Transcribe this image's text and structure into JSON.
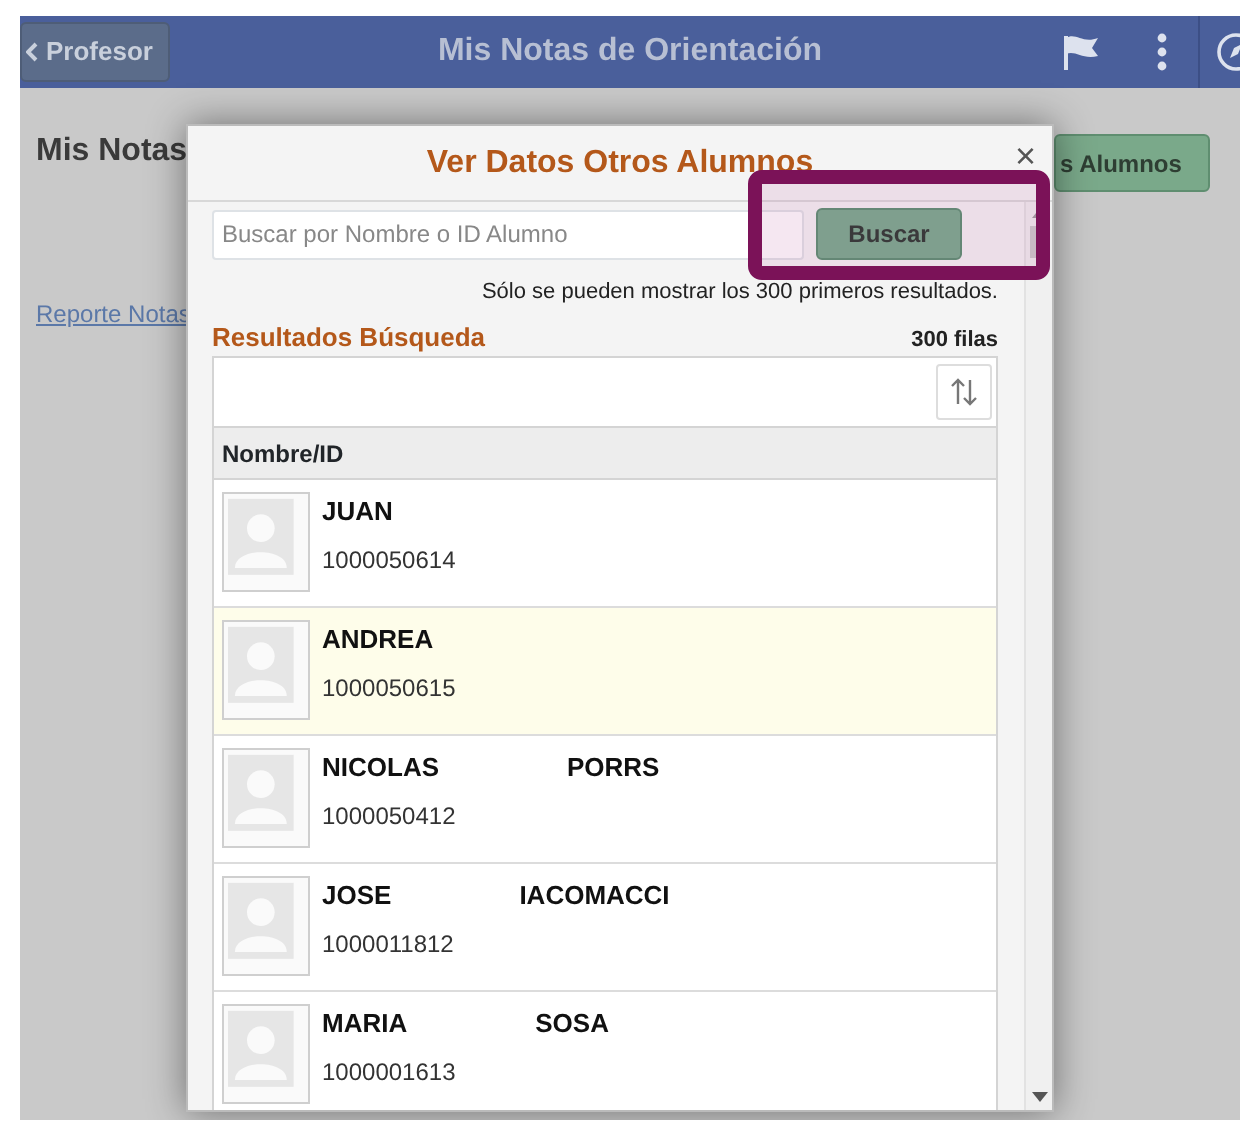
{
  "header": {
    "back_button": "Profesor",
    "title": "Mis Notas de Orientación"
  },
  "background": {
    "page_title": "Mis Notas",
    "link": "Reporte Notas",
    "button": "s Alumnos"
  },
  "modal": {
    "title": "Ver Datos Otros Alumnos",
    "close": "×",
    "search": {
      "placeholder": "Buscar por Nombre o ID Alumno",
      "button": "Buscar"
    },
    "note": "Sólo se pueden mostrar los 300 primeros resultados.",
    "results_title": "Resultados Búsqueda",
    "row_count": "300 filas",
    "column": "Nombre/ID",
    "rows": [
      {
        "first_name": "JUAN",
        "id": "1000050614",
        "selected": false
      },
      {
        "first_name": "ANDREA",
        "id": "1000050615",
        "selected": true
      },
      {
        "first_name": "NICOLAS",
        "last_name": "PORRS",
        "id": "1000050412",
        "selected": false
      },
      {
        "first_name": "JOSE",
        "last_name": "IACOMACCI",
        "id": "1000011812",
        "selected": false
      },
      {
        "first_name": "MARIA",
        "last_name": "SOSA",
        "id": "1000001613",
        "selected": false
      }
    ]
  }
}
